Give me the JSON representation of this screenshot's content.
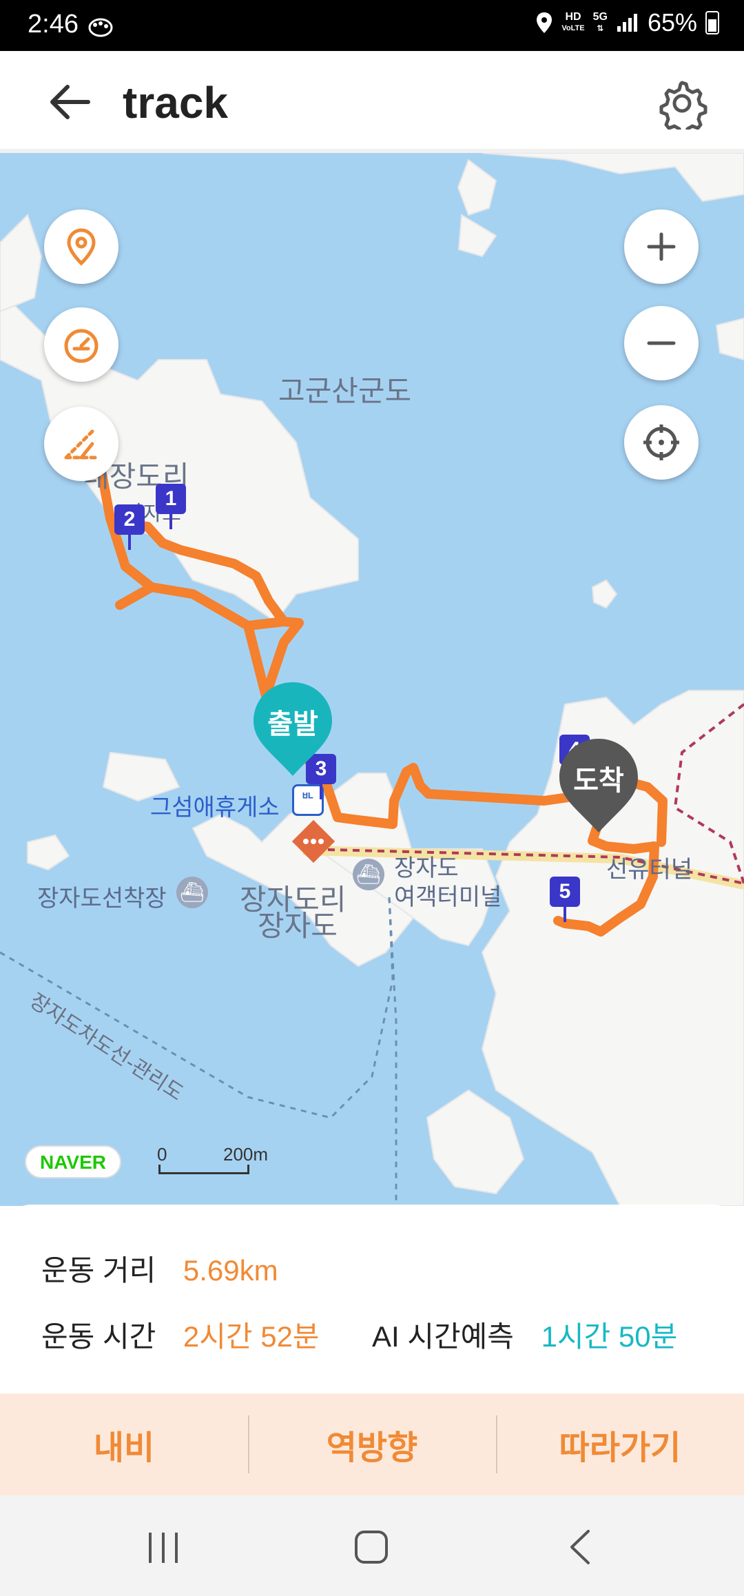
{
  "status_bar": {
    "time": "2:46",
    "network_label": "HD",
    "network_sub": "VoLTE",
    "gen_label": "5G",
    "battery": "65%"
  },
  "header": {
    "title": "track",
    "back_icon": "arrow-left-icon",
    "settings_icon": "gear-icon"
  },
  "map": {
    "labels": {
      "island_title": "고군산군도",
      "village_top": "대장도리",
      "village_top_sub": "장자도",
      "rest_area": "그섬애휴게소",
      "ferry_dock": "장자도선착장",
      "village_center": "장자도리",
      "village_center_sub": "장자도",
      "terminal_line1": "장자도",
      "terminal_line2": "여객터미널",
      "tunnel": "선유터널",
      "ferry_route": "장자도차도선-관리도"
    },
    "waypoints": [
      "1",
      "2",
      "3",
      "4",
      "5"
    ],
    "start_marker": "출발",
    "end_marker": "도착",
    "logo": "NAVER",
    "scale_start": "0",
    "scale_end": "200m",
    "controls": {
      "my_location_icon": "location-pin-icon",
      "speed_icon": "speedometer-icon",
      "altitude_icon": "altitude-icon",
      "zoom_in_icon": "plus-icon",
      "zoom_out_icon": "minus-icon",
      "recenter_icon": "crosshair-icon"
    },
    "colors": {
      "water": "#a6d2f2",
      "land": "#f6f6f4",
      "track": "#f5802e",
      "start": "#19b5bd",
      "end": "#575757",
      "waypoint": "#3a36c8"
    }
  },
  "info": {
    "distance_label": "운동 거리",
    "distance_value": "5.69km",
    "time_label": "운동 시간",
    "time_value": "2시간 52분",
    "ai_label": "AI 시간예측",
    "ai_value": "1시간 50분"
  },
  "actions": {
    "navi": "내비",
    "reverse": "역방향",
    "follow": "따라가기"
  },
  "nav_bar": {
    "recents_icon": "recents-icon",
    "home_icon": "home-icon",
    "back_icon": "back-chevron-icon"
  }
}
